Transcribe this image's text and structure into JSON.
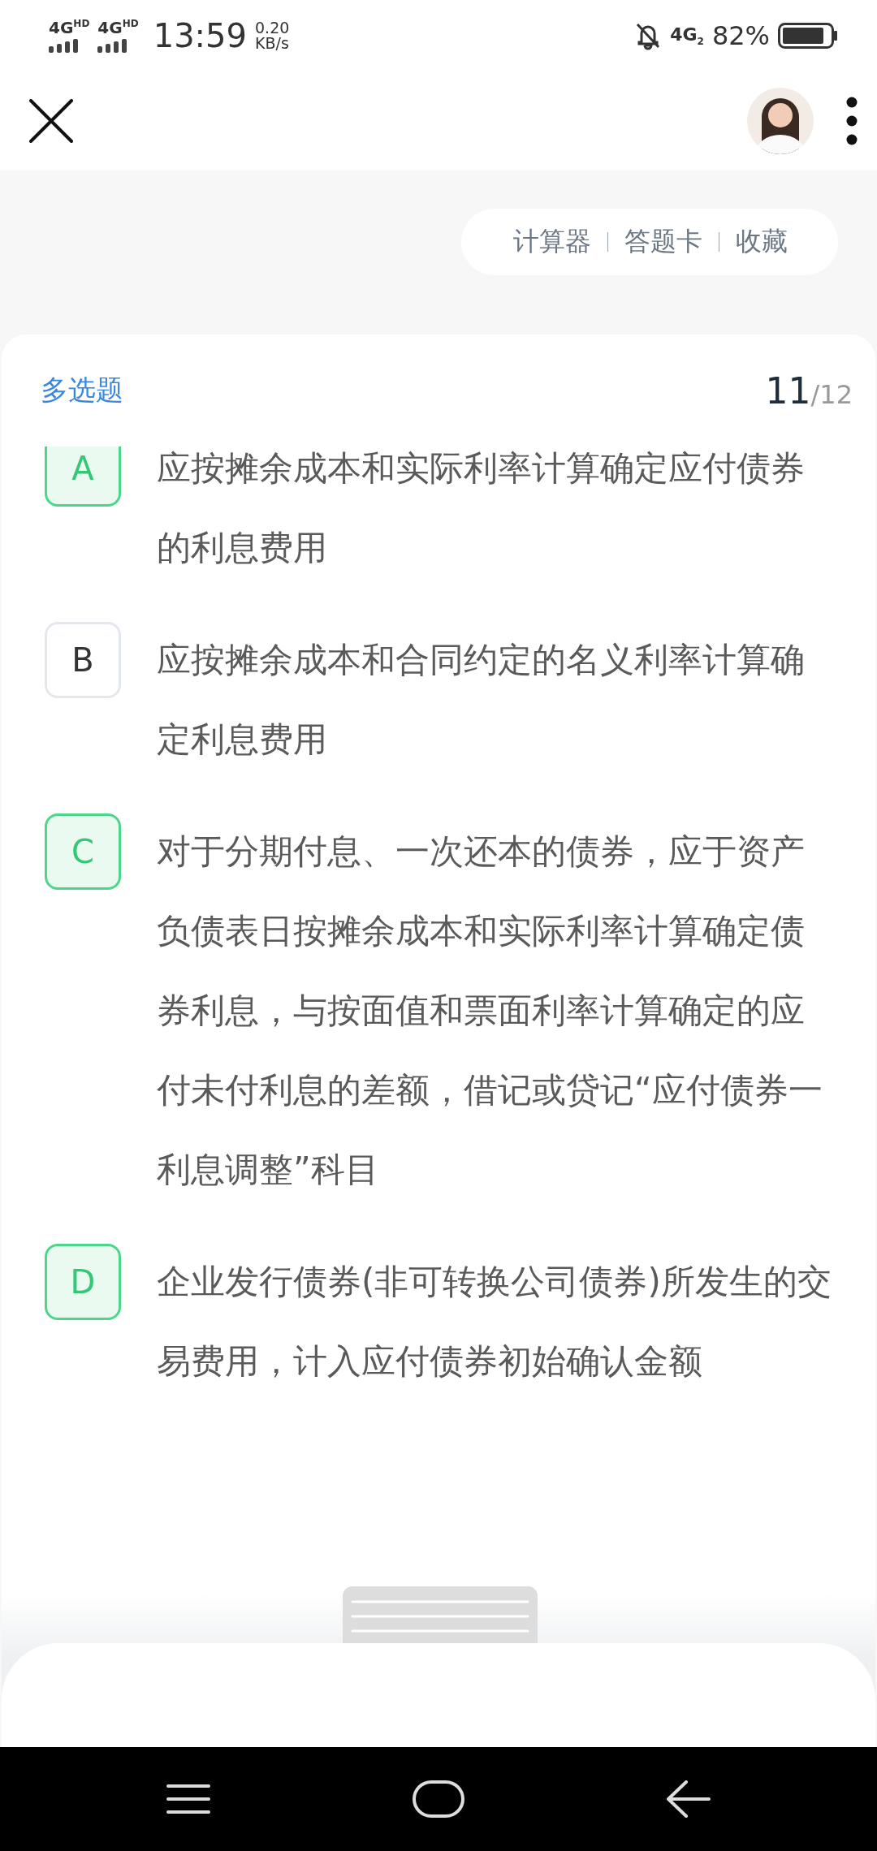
{
  "status_bar": {
    "networks": [
      "4G$^{HD}$",
      "4G$^{HD}$"
    ],
    "time": "13:59",
    "speed": "0.20",
    "speed_unit": "KB/s",
    "sim": "4G$_{2}$",
    "battery": "82%"
  },
  "toolbar": [
    {
      "label": "计算器"
    },
    {
      "label": "答题卡"
    },
    {
      "label": "收藏"
    }
  ],
  "question": {
    "type": "多选题",
    "current": "11",
    "total": "/12"
  },
  "options": [
    {
      "letter": "A",
      "text": "应按摊余成本和实际利率计算确定应付债券的利息费用",
      "selected": true
    },
    {
      "letter": "B",
      "text": "应按摊余成本和合同约定的名义利率计算确定利息费用",
      "selected": false
    },
    {
      "letter": "C",
      "text": "对于分期付息、一次还本的债券，应于资产负债表日按摊余成本和实际利率计算确定债券利息，与按面值和票面利率计算确定的应付未付利息的差额，借记或贷记“应付债券一利息调整”科目",
      "selected": true
    },
    {
      "letter": "D",
      "text": "企业发行债券(非可转换公司债券)所发生的交易费用，计入应付债券初始确认金额",
      "selected": true
    }
  ]
}
